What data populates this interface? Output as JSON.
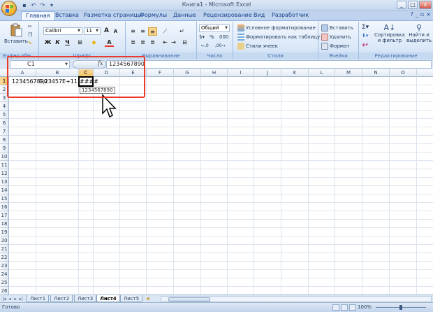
{
  "window": {
    "title": "Книга1 - Microsoft Excel",
    "controls": [
      "_",
      "□",
      "x"
    ]
  },
  "ribbon_tabs": [
    "Главная",
    "Вставка",
    "Разметка страницы",
    "Формулы",
    "Данные",
    "Рецензирование",
    "Вид",
    "Разработчик"
  ],
  "ribbon": {
    "clipboard": {
      "paste": "Вставить",
      "label": "Буфер обм..."
    },
    "font": {
      "name": "Calibri",
      "size": "11",
      "label": "Шрифт"
    },
    "alignment": {
      "label": "Выравнивание"
    },
    "number": {
      "format": "Общий",
      "label": "Число"
    },
    "styles": {
      "conditional": "Условное форматирование",
      "as_table": "Форматировать как таблицу",
      "cell_styles": "Стили ячеек",
      "label": "Стили"
    },
    "cells": {
      "insert": "Вставить",
      "delete": "Удалить",
      "format": "Формат",
      "label": "Ячейки"
    },
    "editing": {
      "sort": "Сортировка\nи фильтр",
      "sort1": "Сортировка",
      "sort2": "и фильтр",
      "find1": "Найти и",
      "find2": "выделить",
      "label": "Редактирование"
    }
  },
  "formula_bar": {
    "name_box": "C1",
    "fx": "fx",
    "value": "1234567890"
  },
  "grid": {
    "columns": [
      "A",
      "B",
      "C",
      "D",
      "E",
      "F",
      "G",
      "H",
      "I",
      "J",
      "K",
      "L",
      "M",
      "N",
      "O"
    ],
    "rows": [
      "1",
      "2",
      "3",
      "4",
      "5",
      "6",
      "7",
      "8",
      "9",
      "10",
      "11",
      "12",
      "13",
      "14",
      "15",
      "16",
      "17",
      "18",
      "19",
      "20",
      "21",
      "22",
      "23",
      "24",
      "25",
      "26"
    ],
    "cells": {
      "A1": "1234567890",
      "B1": "1,23457E+11",
      "C1": "####"
    },
    "tooltip": "1234567890"
  },
  "sheets": [
    "Лист1",
    "Лист2",
    "Лист3",
    "Лист4",
    "Лист5"
  ],
  "active_sheet": "Лист4",
  "status": {
    "ready": "Готово",
    "zoom": "100%"
  },
  "colors": {
    "highlight": "#e8392a",
    "ribbon_bg": "#dbe8f8",
    "selected_header": "#f1c15f"
  }
}
